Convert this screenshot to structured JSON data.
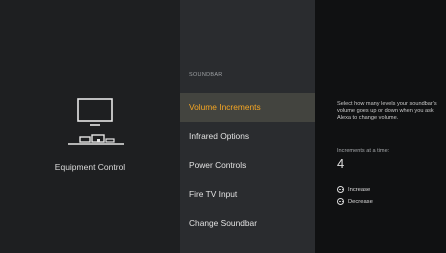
{
  "left_panel": {
    "title": "Equipment Control"
  },
  "menu": {
    "section_label": "SOUNDBAR",
    "items": [
      {
        "label": "Volume Increments",
        "selected": true
      },
      {
        "label": "Infrared Options"
      },
      {
        "label": "Power Controls"
      },
      {
        "label": "Fire TV Input"
      },
      {
        "label": "Change Soundbar"
      }
    ]
  },
  "details": {
    "help_text": "Select how many levels your soundbar's volume goes up or down when you ask Alexa to change volume.",
    "increments_label": "Increments at a time:",
    "increments_value": "4",
    "actions": [
      {
        "icon": "more-options-icon",
        "label": "Increase"
      },
      {
        "icon": "more-options-icon",
        "label": "Decrease"
      }
    ]
  },
  "colors": {
    "selected_text": "#f5a623",
    "selected_bg": "#43443f",
    "middle_bg": "#2a2c2f",
    "right_bg": "#101112"
  }
}
